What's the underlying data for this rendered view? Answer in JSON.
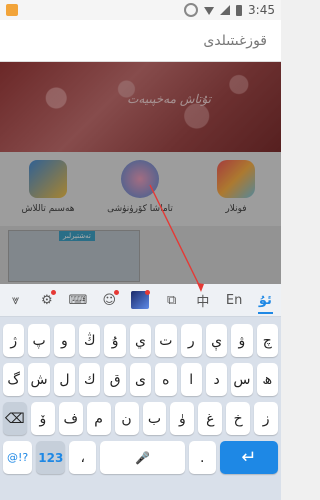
{
  "status_bar": {
    "time": "3:45"
  },
  "search": {
    "text": "قوزغىتىلدى"
  },
  "background": {
    "banner_text": "تۇتاش مەخپىيەت",
    "apps": [
      {
        "label": "ھەسىم تاللاش"
      },
      {
        "label": "تاماشا كۆرۈنۈشى"
      },
      {
        "label": "فونلار"
      }
    ],
    "mini_tag": "تەشتېرلىر"
  },
  "toolbar": {
    "items": [
      {
        "name": "collapse-icon",
        "label": "⩔"
      },
      {
        "name": "settings-icon",
        "label": "⚙"
      },
      {
        "name": "keyboard-layout-icon",
        "label": "⌨"
      },
      {
        "name": "emoji-icon",
        "label": "☺"
      },
      {
        "name": "skin-image-icon",
        "label": ""
      },
      {
        "name": "clipboard-icon",
        "label": "⧉"
      },
      {
        "name": "chinese-input",
        "label": "中"
      },
      {
        "name": "english-input",
        "label": "En"
      },
      {
        "name": "uyghur-input",
        "label": "ئۇ"
      }
    ]
  },
  "keyboard": {
    "row1": [
      "چ",
      "ۋ",
      "ې",
      "ر",
      "ت",
      "ي",
      "ۇ",
      "ڭ",
      "و",
      "پ",
      "ژ"
    ],
    "row2": [
      "ھ",
      "س",
      "د",
      "ا",
      "ە",
      "ى",
      "ق",
      "ك",
      "ل",
      "ش",
      "گ"
    ],
    "row3": [
      "ز",
      "خ",
      "غ",
      "ۈ",
      "ب",
      "ن",
      "م",
      "ف",
      "ۆ"
    ],
    "row3_backspace": "⌫",
    "row4": {
      "symbols": "@!?",
      "numbers": "123",
      "comma": "،",
      "mic": "🎤",
      "period": ".",
      "enter": "↵"
    }
  },
  "colors": {
    "accent": "#1e88e5",
    "arrow": "#e53935"
  }
}
